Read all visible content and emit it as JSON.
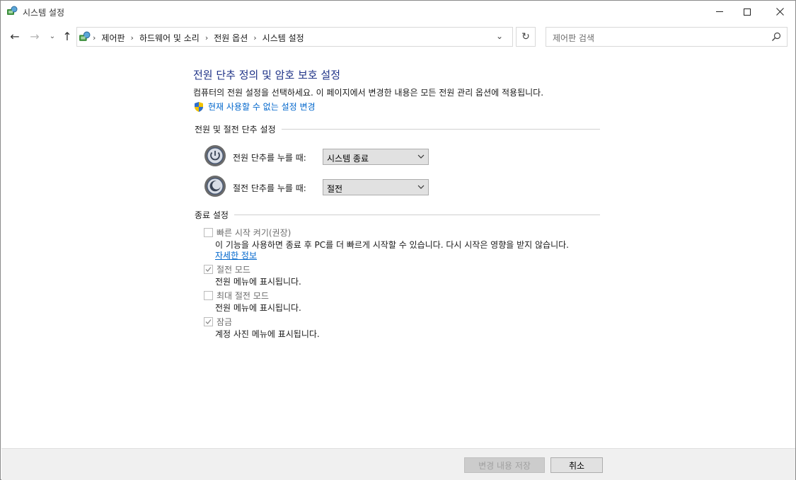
{
  "window": {
    "title": "시스템 설정",
    "icons": {
      "app": "control-panel-icon",
      "minimize": "minimize-icon",
      "maximize": "maximize-icon",
      "close": "close-icon"
    }
  },
  "nav": {
    "back": "←",
    "forward": "→",
    "recent": "⌄",
    "up": "↑",
    "breadcrumbs": [
      "제어판",
      "하드웨어 및 소리",
      "전원 옵션",
      "시스템 설정"
    ],
    "separator": "›",
    "dropdown": "⌄",
    "refresh": "↻",
    "search_placeholder": "제어판 검색"
  },
  "main": {
    "title": "전원 단추 정의 및 암호 보호 설정",
    "description": "컴퓨터의 전원 설정을 선택하세요. 이 페이지에서 변경한 내용은 모든 전원 관리 옵션에 적용됩니다.",
    "change_link": "현재 사용할 수 없는 설정 변경",
    "power_section": {
      "header": "전원 및 절전 단추 설정",
      "rows": [
        {
          "label": "전원 단추를 누를 때:",
          "value": "시스템 종료",
          "icon": "power-button-icon"
        },
        {
          "label": "절전 단추를 누를 때:",
          "value": "절전",
          "icon": "sleep-button-icon"
        }
      ]
    },
    "shutdown_section": {
      "header": "종료 설정",
      "items": [
        {
          "label": "빠른 시작 켜기(권장)",
          "checked": false,
          "desc": "이 기능을 사용하면 종료 후 PC를 더 빠르게 시작할 수 있습니다. 다시 시작은 영향을 받지 않습니다.",
          "more_link": "자세한 정보"
        },
        {
          "label": "절전 모드",
          "checked": true,
          "desc": "전원 메뉴에 표시됩니다."
        },
        {
          "label": "최대 절전 모드",
          "checked": false,
          "desc": "전원 메뉴에 표시됩니다."
        },
        {
          "label": "잠금",
          "checked": true,
          "desc": "계정 사진 메뉴에 표시됩니다."
        }
      ]
    }
  },
  "footer": {
    "save": "변경 내용 저장",
    "cancel": "취소"
  },
  "colors": {
    "title": "#1e3287",
    "link": "#0066cc",
    "disabled_text": "#6d6d6d",
    "bottom_bar": "#f0f0f0"
  }
}
